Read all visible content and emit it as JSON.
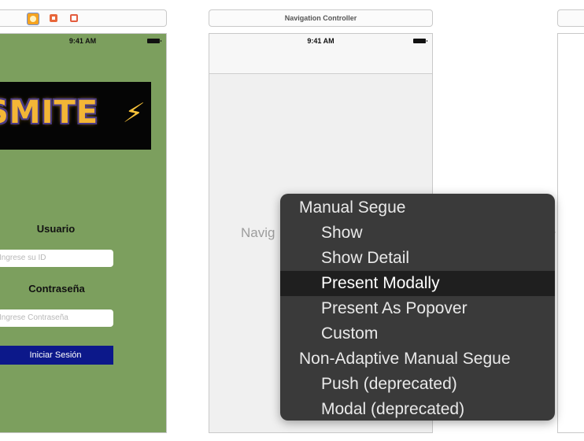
{
  "scenes": {
    "login": {
      "status_time": "9:41 AM",
      "logo_text": "SMITE",
      "username_label": "Usuario",
      "username_placeholder": "Ingrese su ID",
      "password_label": "Contraseña",
      "password_placeholder": "Ingrese Contraseña",
      "login_button": "Iniciar Sesión"
    },
    "navigation": {
      "header_title": "Navigation Controller",
      "status_time": "9:41 AM",
      "body_label": "Navig"
    }
  },
  "context_menu": {
    "items": [
      {
        "label": "Manual Segue",
        "kind": "header"
      },
      {
        "label": "Show",
        "kind": "option"
      },
      {
        "label": "Show Detail",
        "kind": "option"
      },
      {
        "label": "Present Modally",
        "kind": "option",
        "highlighted": true
      },
      {
        "label": "Present As Popover",
        "kind": "option"
      },
      {
        "label": "Custom",
        "kind": "option"
      },
      {
        "label": "Non-Adaptive Manual Segue",
        "kind": "header"
      },
      {
        "label": "Push (deprecated)",
        "kind": "option"
      },
      {
        "label": "Modal (deprecated)",
        "kind": "option"
      }
    ]
  },
  "colors": {
    "login_background": "#7c9f5e",
    "login_button": "#0c188a",
    "menu_background": "#3a3a3a",
    "menu_highlight": "#1f1f1f"
  }
}
